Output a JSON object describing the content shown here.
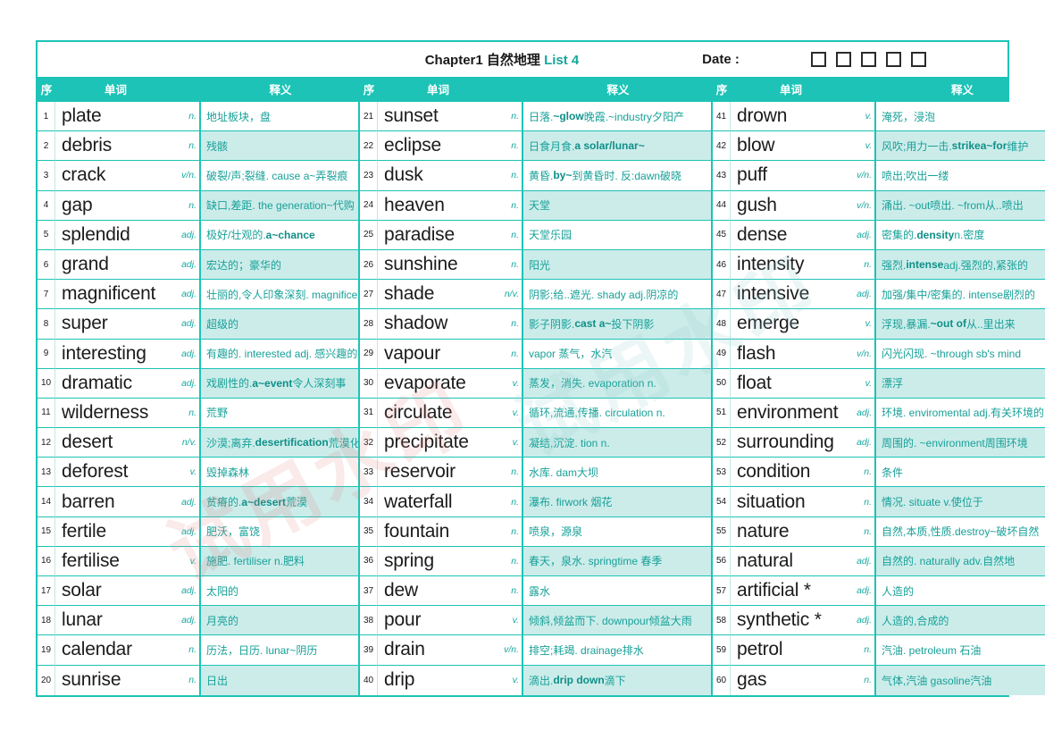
{
  "header": {
    "title_prefix": "Chapter1 自然地理",
    "list_label": "List 4",
    "date_label": "Date :",
    "checkbox_count": 5,
    "accent_color": "#1dc3b6",
    "row_alt_color": "#ccecea",
    "def_text_color": "#17a198"
  },
  "columns": {
    "seq": "序",
    "word": "单词",
    "definition": "释义"
  },
  "entries": [
    {
      "n": "1",
      "word": "plate",
      "pos": "n.",
      "def": "地址板块，盘"
    },
    {
      "n": "2",
      "word": "debris",
      "pos": "n.",
      "def": "残骸"
    },
    {
      "n": "3",
      "word": "crack",
      "pos": "v/n.",
      "def": "破裂/声;裂缝. cause a~弄裂痕"
    },
    {
      "n": "4",
      "word": "gap",
      "pos": "n.",
      "def": "缺口,差距. the generation~代购"
    },
    {
      "n": "5",
      "word": "splendid",
      "pos": "adj.",
      "def": "极好/壮观的. <b>a~chance</b>"
    },
    {
      "n": "6",
      "word": "grand",
      "pos": "adj.",
      "def": "宏达的；豪华的"
    },
    {
      "n": "7",
      "word": "magnificent",
      "pos": "adj.",
      "def": "壮丽的,令人印象深刻. magnificence"
    },
    {
      "n": "8",
      "word": "super",
      "pos": "adj.",
      "def": "超级的"
    },
    {
      "n": "9",
      "word": "interesting",
      "pos": "adj.",
      "def": "有趣的. interested adj. 感兴趣的"
    },
    {
      "n": "10",
      "word": "dramatic",
      "pos": "adj.",
      "def": "戏剧性的. <b>a~event</b>令人深刻事"
    },
    {
      "n": "11",
      "word": "wilderness",
      "pos": "n.",
      "def": "荒野"
    },
    {
      "n": "12",
      "word": "desert",
      "pos": "n/v.",
      "def": "沙漠;离弃.<b>desertification</b>荒漠化"
    },
    {
      "n": "13",
      "word": "deforest",
      "pos": "v.",
      "def": "毁掉森林"
    },
    {
      "n": "14",
      "word": "barren",
      "pos": "adj.",
      "def": "贫瘠的. <b>a~desert</b>荒漠"
    },
    {
      "n": "15",
      "word": "fertile",
      "pos": "adj.",
      "def": "肥沃，富饶"
    },
    {
      "n": "16",
      "word": "fertilise",
      "pos": "v.",
      "def": "施肥. fertiliser n.肥料"
    },
    {
      "n": "17",
      "word": "solar",
      "pos": "adj.",
      "def": "太阳的"
    },
    {
      "n": "18",
      "word": "lunar",
      "pos": "adj.",
      "def": "月亮的"
    },
    {
      "n": "19",
      "word": "calendar",
      "pos": "n.",
      "def": "历法，日历. lunar~阴历"
    },
    {
      "n": "20",
      "word": "sunrise",
      "pos": "n.",
      "def": "日出"
    },
    {
      "n": "21",
      "word": "sunset",
      "pos": "n.",
      "def": "日落. <b>~glow</b>晚霞.~industry夕阳产"
    },
    {
      "n": "22",
      "word": "eclipse",
      "pos": "n.",
      "def": "日食月食. <b>a solar/lunar~</b>"
    },
    {
      "n": "23",
      "word": "dusk",
      "pos": "n.",
      "def": "黄昏. <b>by~</b>到黄昏时. 反:dawn破晓"
    },
    {
      "n": "24",
      "word": "heaven",
      "pos": "n.",
      "def": "天堂"
    },
    {
      "n": "25",
      "word": "paradise",
      "pos": "n.",
      "def": "天堂乐园"
    },
    {
      "n": "26",
      "word": "sunshine",
      "pos": "n.",
      "def": "阳光"
    },
    {
      "n": "27",
      "word": "shade",
      "pos": "n/v.",
      "def": "阴影;给..遮光. shady adj.阴凉的"
    },
    {
      "n": "28",
      "word": "shadow",
      "pos": "n.",
      "def": "影子阴影. <b>cast a~</b>投下阴影"
    },
    {
      "n": "29",
      "word": "vapour",
      "pos": "n.",
      "def": "vapor 蒸气，水汽"
    },
    {
      "n": "30",
      "word": "evaporate",
      "pos": "v.",
      "def": "蒸发，消失. evaporation n."
    },
    {
      "n": "31",
      "word": "circulate",
      "pos": "v.",
      "def": "循环,流通,传播. circulation n."
    },
    {
      "n": "32",
      "word": "precipitate",
      "pos": "v.",
      "def": "凝结,沉淀. tion n."
    },
    {
      "n": "33",
      "word": "reservoir",
      "pos": "n.",
      "def": "水库. dam大坝"
    },
    {
      "n": "34",
      "word": "waterfall",
      "pos": "n.",
      "def": "瀑布. firwork 烟花"
    },
    {
      "n": "35",
      "word": "fountain",
      "pos": "n.",
      "def": "喷泉，源泉"
    },
    {
      "n": "36",
      "word": "spring",
      "pos": "n.",
      "def": "春天，泉水. springtime 春季"
    },
    {
      "n": "37",
      "word": "dew",
      "pos": "n.",
      "def": "露水"
    },
    {
      "n": "38",
      "word": "pour",
      "pos": "v.",
      "def": "倾斜,倾盆而下. downpour倾盆大雨"
    },
    {
      "n": "39",
      "word": "drain",
      "pos": "v/n.",
      "def": "排空;耗竭. drainage排水"
    },
    {
      "n": "40",
      "word": "drip",
      "pos": "v.",
      "def": "滴出. <b>drip down</b>滴下"
    },
    {
      "n": "41",
      "word": "drown",
      "pos": "v.",
      "def": "淹死，浸泡"
    },
    {
      "n": "42",
      "word": "blow",
      "pos": "v.",
      "def": "风吹;用力一击. <b>strikea~for</b>维护"
    },
    {
      "n": "43",
      "word": "puff",
      "pos": "v/n.",
      "def": "喷出;吹出一缕"
    },
    {
      "n": "44",
      "word": "gush",
      "pos": "v/n.",
      "def": "涌出. ~out喷出. ~from从..喷出"
    },
    {
      "n": "45",
      "word": "dense",
      "pos": "adj.",
      "def": "密集的. <b>density</b> n.密度"
    },
    {
      "n": "46",
      "word": "intensity",
      "pos": "n.",
      "def": "强烈. <b>intense</b> adj.强烈的,紧张的"
    },
    {
      "n": "47",
      "word": "intensive",
      "pos": "adj.",
      "def": "加强/集中/密集的. intense剧烈的"
    },
    {
      "n": "48",
      "word": "emerge",
      "pos": "v.",
      "def": "浮现,暴漏. <b>~out of</b>从..里出来"
    },
    {
      "n": "49",
      "word": "flash",
      "pos": "v/n.",
      "def": "闪光闪现. ~through sb's mind"
    },
    {
      "n": "50",
      "word": "float",
      "pos": "v.",
      "def": "漂浮"
    },
    {
      "n": "51",
      "word": "environment",
      "pos": "adj.",
      "def": "环境. enviromental adj.有关环境的"
    },
    {
      "n": "52",
      "word": "surrounding",
      "pos": "adj.",
      "def": "周围的. ~environment周围环境"
    },
    {
      "n": "53",
      "word": "condition",
      "pos": "n.",
      "def": "条件"
    },
    {
      "n": "54",
      "word": "situation",
      "pos": "n.",
      "def": "情况. situate v.使位于"
    },
    {
      "n": "55",
      "word": "nature",
      "pos": "n.",
      "def": "自然,本质,性质.destroy~破坏自然"
    },
    {
      "n": "56",
      "word": "natural",
      "pos": "adj.",
      "def": "自然的. naturally adv.自然地"
    },
    {
      "n": "57",
      "word": "artificial *",
      "pos": "adj.",
      "def": "人造的"
    },
    {
      "n": "58",
      "word": "synthetic *",
      "pos": "adj.",
      "def": "人造的,合成的"
    },
    {
      "n": "59",
      "word": "petrol",
      "pos": "n.",
      "def": "汽油. petroleum 石油"
    },
    {
      "n": "60",
      "word": "gas",
      "pos": "n.",
      "def": "气体,汽油 gasoline汽油"
    }
  ],
  "watermark": {
    "text1": "试用水印",
    "text2": "试用水印"
  }
}
